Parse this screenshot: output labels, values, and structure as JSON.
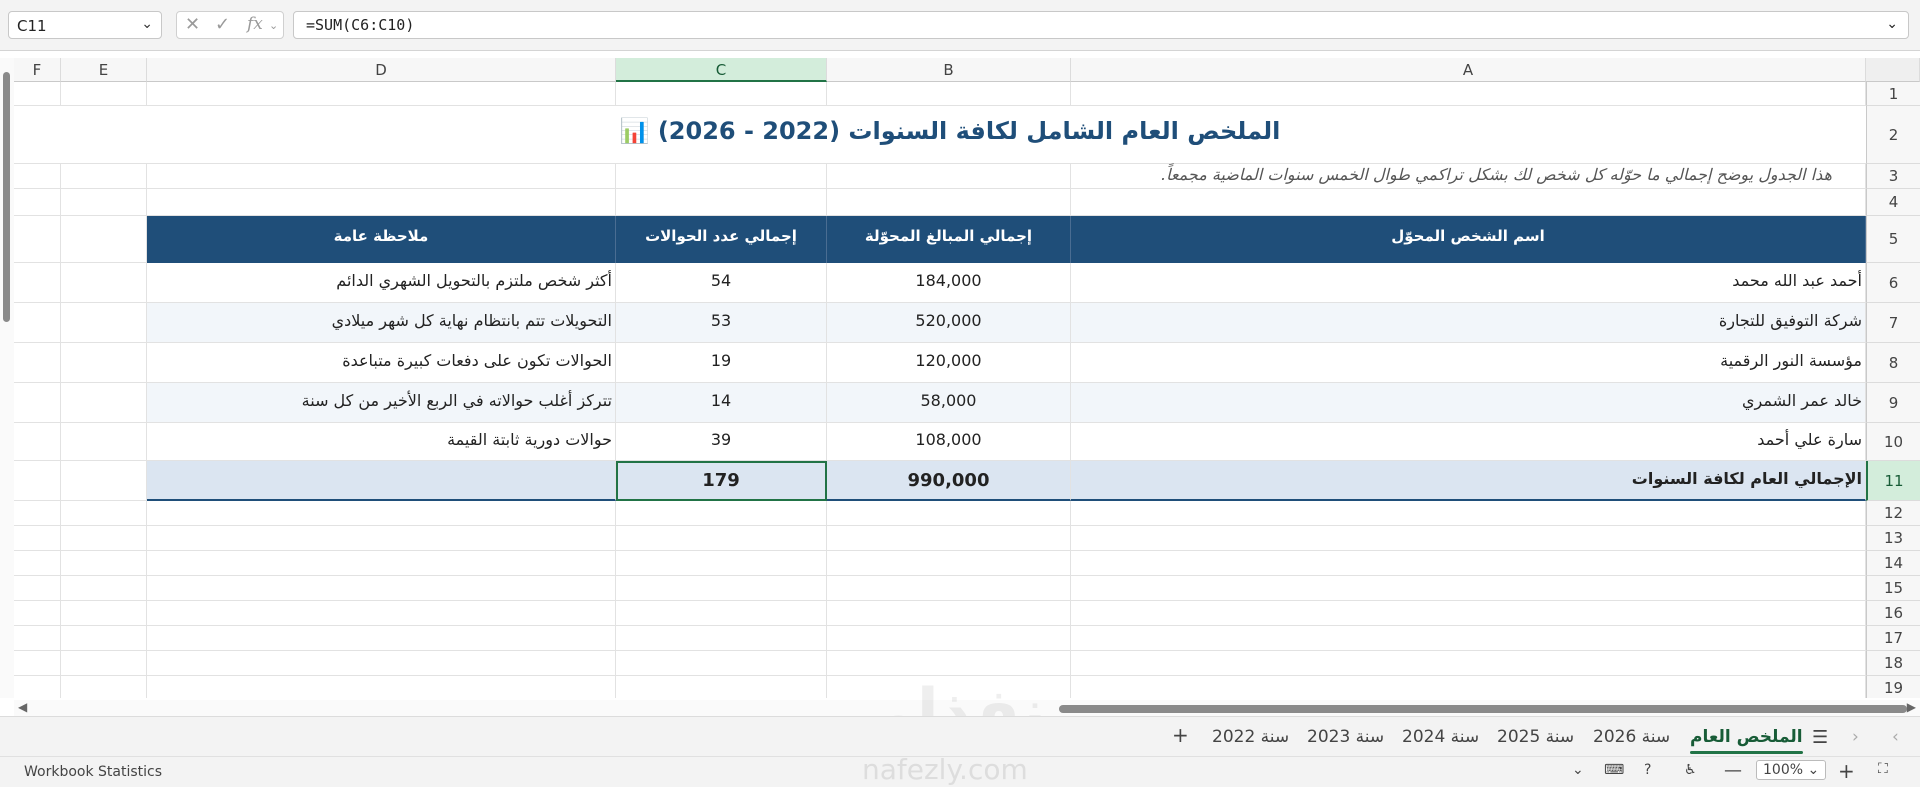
{
  "formula_bar": {
    "name_box": "C11",
    "formula": "=SUM(C6:C10)",
    "fx_label": "fx"
  },
  "columns": [
    "F",
    "E",
    "D",
    "C",
    "B",
    "A"
  ],
  "rows": [
    "1",
    "2",
    "3",
    "4",
    "5",
    "6",
    "7",
    "8",
    "9",
    "10",
    "11",
    "12",
    "13",
    "14",
    "15",
    "16",
    "17",
    "18",
    "19"
  ],
  "sheet": {
    "title": "الملخص العام الشامل لكافة السنوات (2022 - 2026)",
    "title_icon": "📊",
    "subtitle": "هذا الجدول يوضح إجمالي ما حوّله كل شخص لك بشكل تراكمي طوال الخمس سنوات الماضية مجمعاً.",
    "headers": {
      "a": "اسم الشخص المحوّل",
      "b": "إجمالي المبالغ المحوّلة",
      "c": "إجمالي عدد الحوالات",
      "d": "ملاحظة عامة"
    },
    "data_rows": [
      {
        "a": "أحمد عبد الله محمد",
        "b": "184,000",
        "c": "54",
        "d": "أكثر شخص ملتزم بالتحويل الشهري الدائم"
      },
      {
        "a": "شركة التوفيق للتجارة",
        "b": "520,000",
        "c": "53",
        "d": "التحويلات تتم بانتظام نهاية كل شهر ميلادي"
      },
      {
        "a": "مؤسسة النور الرقمية",
        "b": "120,000",
        "c": "19",
        "d": "الحوالات تكون على دفعات كبيرة متباعدة"
      },
      {
        "a": "خالد عمر الشمري",
        "b": "58,000",
        "c": "14",
        "d": "تتركز أغلب حوالاته في الربع الأخير من كل سنة"
      },
      {
        "a": "سارة علي أحمد",
        "b": "108,000",
        "c": "39",
        "d": "حوالات دورية ثابتة القيمة"
      }
    ],
    "total_row": {
      "a": "الإجمالي العام لكافة السنوات",
      "b": "990,000",
      "c": "179",
      "d": ""
    }
  },
  "tabs": {
    "active": "الملخص العام",
    "items": [
      "سنة 2026",
      "سنة 2025",
      "سنة 2024",
      "سنة 2023",
      "سنة 2022"
    ],
    "add": "+"
  },
  "status": {
    "left": "Workbook Statistics",
    "zoom": "100%"
  },
  "watermark": {
    "arabic": "نفذلي",
    "latin": "nafezly.com"
  }
}
